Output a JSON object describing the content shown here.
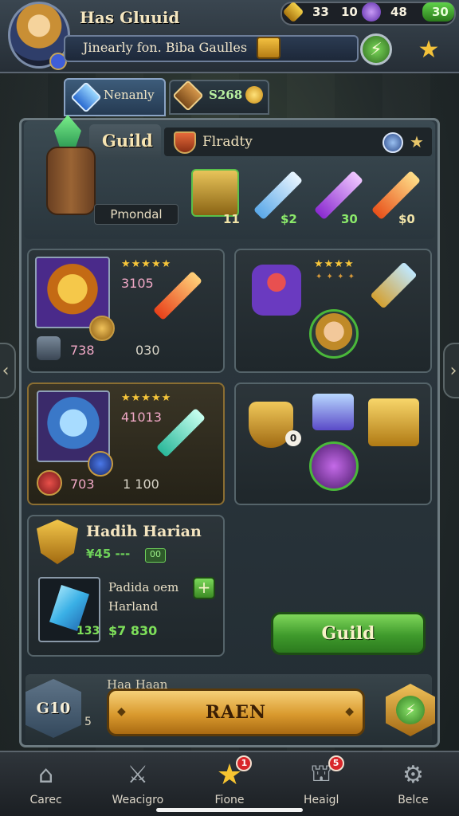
{
  "header": {
    "title": "Has Gluuid",
    "subtitle": "Jinearly fon. Biba Gaulles",
    "resources": [
      {
        "icon": "gold-gem-icon",
        "value": "33"
      },
      {
        "icon": "purple-orb-icon",
        "value": "10"
      },
      {
        "icon": "energy-icon",
        "value": "48"
      },
      {
        "icon": "green-gem-icon",
        "value": "30"
      }
    ]
  },
  "currency_tabs": [
    {
      "label": "Nenanly",
      "icon": "blue-gem-icon"
    },
    {
      "label": "S268",
      "icon": "chest-icon"
    }
  ],
  "panel": {
    "guild_tab": "Guild",
    "friends_label": "Flradty",
    "banner_label": "Pmondal",
    "slots": [
      {
        "icon": "gold-tablet-icon",
        "value": "11"
      },
      {
        "icon": "blue-sword-icon",
        "value": "$2"
      },
      {
        "icon": "purple-sword-icon",
        "value": "30"
      },
      {
        "icon": "fire-sword-icon",
        "value": "$0"
      }
    ]
  },
  "cards": [
    {
      "stars": "★★★★★",
      "value": "3105",
      "left_num": "738",
      "right_num": "030"
    },
    {
      "stars": "★★★★",
      "stars2": "✦ ✦ ✦ ✦"
    },
    {
      "stars": "★★★★★",
      "value": "41013",
      "left_num": "703",
      "right_num": "1 100"
    },
    {
      "badge": "0"
    }
  ],
  "hadih": {
    "title": "Hadih Harian",
    "subtitle": "¥45 ‑‑‑",
    "badge": "00",
    "item_line1": "Padida oem",
    "item_line2": "Harland",
    "item_qty": "133",
    "item_price": "$7 830",
    "plus": "+"
  },
  "guild_button": "Guild",
  "bottom": {
    "level": "G10",
    "level_small": "5",
    "hidden_name": "Haa Haan",
    "main_button": "RAEN"
  },
  "nav": [
    {
      "icon": "home-icon",
      "label": "Carec",
      "badge": ""
    },
    {
      "icon": "weapon-icon",
      "label": "Weacigro",
      "badge": ""
    },
    {
      "icon": "star-icon",
      "label": "Fione",
      "badge": "1"
    },
    {
      "icon": "headquarters-icon",
      "label": "Heaigl",
      "badge": "5"
    },
    {
      "icon": "settings-gear-icon",
      "label": "Belce",
      "badge": ""
    }
  ]
}
